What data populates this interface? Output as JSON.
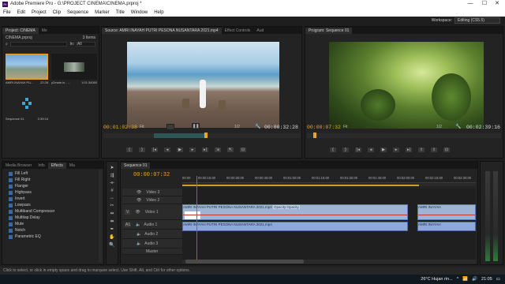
{
  "window": {
    "title": "Adobe Premiere Pro - G:\\PROJECT CINEMA\\CINEMA.prproj *",
    "minimize": "—",
    "maximize": "☐",
    "close": "✕"
  },
  "menu": [
    "File",
    "Edit",
    "Project",
    "Clip",
    "Sequence",
    "Marker",
    "Title",
    "Window",
    "Help"
  ],
  "workspace": {
    "label": "Workspace:",
    "value": "Editing (CS5.5)"
  },
  "project": {
    "tab": "Project: CINEMA",
    "tab2": "Me",
    "name": "CINEMA.prproj",
    "items_count": "3 Items",
    "in_label": "In:",
    "in_value": "All",
    "items": [
      {
        "name": "AMRI INAYAH PU...",
        "duration": "22:28"
      },
      {
        "name": "y2mate.is - ...",
        "duration": "1:01:34060"
      },
      {
        "name": "Sequence 01",
        "duration": "2:39:16"
      }
    ]
  },
  "source": {
    "tabs": [
      "Source: AMRI INAYAH PUTRI PESONA NUSANTARA 2021.mp4",
      "Effect Controls",
      "Aud"
    ],
    "timecode": "00:01:02:38",
    "fit": "Fit",
    "ratio": "1/2",
    "duration": "00:00:32:28"
  },
  "program": {
    "tab": "Program: Sequence 01",
    "timecode": "00:00:07:32",
    "fit": "Fit",
    "ratio": "1/2",
    "duration": "00:02:39:16"
  },
  "effects": {
    "tabs": [
      "Media Browser",
      "Info",
      "Effects",
      "Ma"
    ],
    "items": [
      "Fill Left",
      "Fill Right",
      "Flanger",
      "Highpass",
      "Invert",
      "Lowpass",
      "Multiband Compressor",
      "Multitap Delay",
      "Mute",
      "Notch",
      "Parametric EQ"
    ]
  },
  "timeline": {
    "tab": "Sequence 01",
    "timecode": "00:00:07:32",
    "ruler": [
      "00:00",
      "00:00:15:00",
      "00:00:30:00",
      "00:00:45:00",
      "00:01:00:00",
      "00:01:15:00",
      "00:01:30:00",
      "00:01:45:00",
      "00:02:00:00",
      "00:02:15:00",
      "00:02:30:00"
    ],
    "tracks": {
      "video3": "Video 3",
      "video2": "Video 2",
      "video1": "Video 1",
      "audio1": "Audio 1",
      "audio2": "Audio 2",
      "audio3": "Audio 3",
      "master": "Master"
    },
    "labels": {
      "v": "V",
      "a1": "A1"
    },
    "video_clip": "AMRI INAYAH PUTRI PESONA NUSANTARA 2021.mp4",
    "video_opacity": "Opacity:Opacity",
    "audio_clip": "AMRI INAYAH PUTRI PESONA NUSANTARA 2021.mp4",
    "video_clip2": "AMRI INAYAH",
    "audio_clip2": "AMRI INAYAH"
  },
  "status": "Click to select, or click in empty space and drag to marquee select. Use Shift, Alt, and Ctrl for other options.",
  "taskbar": {
    "weather": "26°C  Hujan rin...",
    "time": "21:05"
  }
}
